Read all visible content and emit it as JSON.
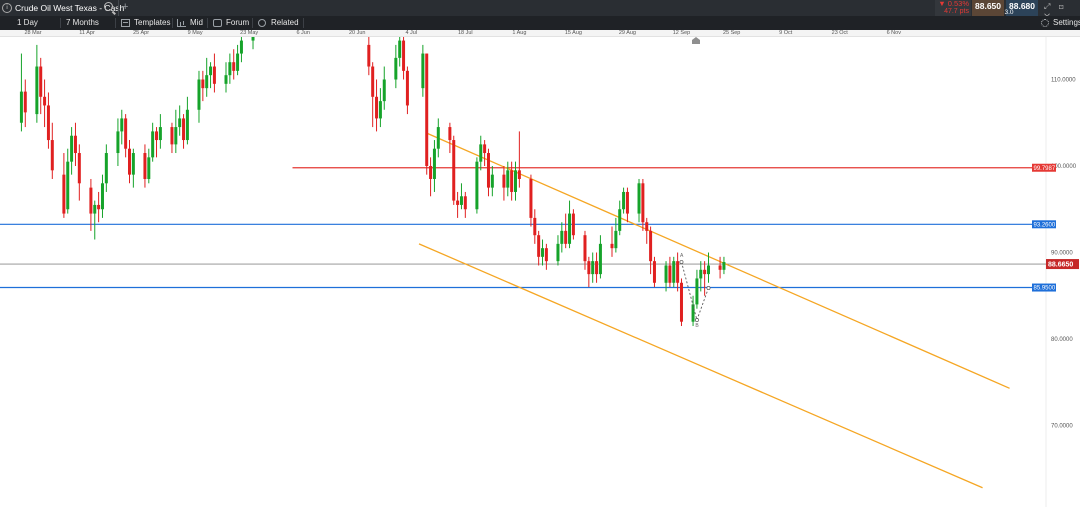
{
  "window": {
    "title": "Crude Oil West Texas - Cash",
    "info_icon": "info-icon",
    "search_icon": "search-icon",
    "add_icon": "plus-icon"
  },
  "quote": {
    "change_pct": "▼ 0.53%",
    "change_pts": "47.7 pts",
    "sell": "88.650",
    "spread": "3.0",
    "buy": "88.680",
    "window_controls": "⤢ ⊡ ✕",
    "colors": {
      "down": "#e53935",
      "sell_bg": "#5b4636",
      "buy_bg": "#2c4359"
    }
  },
  "toolbar": {
    "interval": "1 Day",
    "range": "7 Months",
    "templates": "Templates",
    "mid": "Mid",
    "forum": "Forum",
    "related": "Related",
    "settings": "Settings"
  },
  "date_axis": [
    {
      "label": "28 Mar",
      "day": 0
    },
    {
      "label": "11 Apr",
      "day": 14
    },
    {
      "label": "25 Apr",
      "day": 28
    },
    {
      "label": "9 May",
      "day": 42
    },
    {
      "label": "23 May",
      "day": 56
    },
    {
      "label": "6 Jun",
      "day": 70
    },
    {
      "label": "20 Jun",
      "day": 84
    },
    {
      "label": "4 Jul",
      "day": 98
    },
    {
      "label": "18 Jul",
      "day": 112
    },
    {
      "label": "1 Aug",
      "day": 126
    },
    {
      "label": "15 Aug",
      "day": 140
    },
    {
      "label": "29 Aug",
      "day": 154
    },
    {
      "label": "12 Sep",
      "day": 168
    },
    {
      "label": "25 Sep",
      "day": 181
    },
    {
      "label": "9 Oct",
      "day": 195
    },
    {
      "label": "23 Oct",
      "day": 209
    },
    {
      "label": "6 Nov",
      "day": 223
    }
  ],
  "price_axis": [
    "110.0000",
    "100.0000",
    "90.0000",
    "80.0000",
    "70.0000"
  ],
  "chart_data": {
    "type": "candlestick",
    "instrument": "Crude Oil West Texas - Cash",
    "interval": "1 Day",
    "x_range": [
      "2022-03-25",
      "2022-11-15"
    ],
    "y_range": [
      63,
      118
    ],
    "current_price": {
      "value": 88.665,
      "label": "88.6650"
    },
    "horizontal_levels": [
      {
        "price": 99.7987,
        "label": "99.7987",
        "color": "#e53935",
        "start_day": 75
      },
      {
        "price": 93.26,
        "label": "93.2600",
        "color": "#1e6fd9",
        "start_day": -3
      },
      {
        "price": 85.95,
        "label": "85.9500",
        "color": "#1e6fd9",
        "start_day": -3
      }
    ],
    "channel": {
      "color": "#f5a623",
      "upper": [
        {
          "day": 102,
          "price": 103.8
        },
        {
          "day": 253,
          "price": 74.3
        }
      ],
      "lower": [
        {
          "day": 100,
          "price": 91.0
        },
        {
          "day": 246,
          "price": 62.8
        }
      ]
    },
    "projection": {
      "color": "#555555",
      "points": [
        {
          "day": 168,
          "price": 88.9,
          "label": "A"
        },
        {
          "day": 172,
          "price": 82.2,
          "label": "B"
        },
        {
          "day": 175,
          "price": 85.9,
          "label": ""
        }
      ]
    },
    "candles": [
      {
        "d": -3,
        "o": 105.0,
        "c": 108.6,
        "h": 113.0,
        "l": 104.0
      },
      {
        "d": -2,
        "o": 108.6,
        "c": 106.2,
        "h": 110.0,
        "l": 104.5
      },
      {
        "d": 1,
        "o": 106.0,
        "c": 111.5,
        "h": 114.0,
        "l": 105.0
      },
      {
        "d": 2,
        "o": 111.5,
        "c": 108.0,
        "h": 112.5,
        "l": 106.0
      },
      {
        "d": 3,
        "o": 108.0,
        "c": 107.0,
        "h": 110.0,
        "l": 104.5
      },
      {
        "d": 4,
        "o": 107.0,
        "c": 103.0,
        "h": 108.5,
        "l": 102.0
      },
      {
        "d": 5,
        "o": 103.0,
        "c": 99.5,
        "h": 105.0,
        "l": 98.5
      },
      {
        "d": 8,
        "o": 99.0,
        "c": 94.5,
        "h": 101.5,
        "l": 94.0
      },
      {
        "d": 9,
        "o": 95.0,
        "c": 100.5,
        "h": 102.0,
        "l": 94.5
      },
      {
        "d": 10,
        "o": 100.5,
        "c": 103.5,
        "h": 104.5,
        "l": 99.0
      },
      {
        "d": 11,
        "o": 103.5,
        "c": 101.5,
        "h": 105.0,
        "l": 100.0
      },
      {
        "d": 12,
        "o": 101.5,
        "c": 98.0,
        "h": 102.5,
        "l": 96.0
      },
      {
        "d": 15,
        "o": 97.5,
        "c": 94.5,
        "h": 98.5,
        "l": 92.5
      },
      {
        "d": 16,
        "o": 94.5,
        "c": 95.5,
        "h": 96.0,
        "l": 91.5
      },
      {
        "d": 17,
        "o": 95.5,
        "c": 95.0,
        "h": 97.0,
        "l": 93.5
      },
      {
        "d": 18,
        "o": 95.0,
        "c": 98.0,
        "h": 99.0,
        "l": 94.0
      },
      {
        "d": 19,
        "o": 98.0,
        "c": 101.5,
        "h": 102.5,
        "l": 97.0
      },
      {
        "d": 22,
        "o": 101.5,
        "c": 104.0,
        "h": 105.5,
        "l": 100.0
      },
      {
        "d": 23,
        "o": 104.0,
        "c": 105.5,
        "h": 106.5,
        "l": 102.5
      },
      {
        "d": 24,
        "o": 105.5,
        "c": 102.0,
        "h": 106.0,
        "l": 101.0
      },
      {
        "d": 25,
        "o": 102.0,
        "c": 99.0,
        "h": 103.0,
        "l": 98.0
      },
      {
        "d": 26,
        "o": 99.0,
        "c": 101.5,
        "h": 102.0,
        "l": 97.5
      },
      {
        "d": 29,
        "o": 101.5,
        "c": 98.5,
        "h": 102.5,
        "l": 97.5
      },
      {
        "d": 30,
        "o": 98.5,
        "c": 101.0,
        "h": 102.0,
        "l": 98.0
      },
      {
        "d": 31,
        "o": 101.0,
        "c": 104.0,
        "h": 105.0,
        "l": 100.5
      },
      {
        "d": 32,
        "o": 104.0,
        "c": 103.0,
        "h": 104.5,
        "l": 101.0
      },
      {
        "d": 33,
        "o": 103.0,
        "c": 104.5,
        "h": 106.0,
        "l": 102.0
      },
      {
        "d": 36,
        "o": 104.5,
        "c": 102.5,
        "h": 105.0,
        "l": 101.5
      },
      {
        "d": 37,
        "o": 102.5,
        "c": 104.5,
        "h": 106.5,
        "l": 101.5
      },
      {
        "d": 38,
        "o": 104.5,
        "c": 105.5,
        "h": 107.0,
        "l": 103.5
      },
      {
        "d": 39,
        "o": 105.5,
        "c": 103.0,
        "h": 106.0,
        "l": 102.0
      },
      {
        "d": 40,
        "o": 103.0,
        "c": 106.5,
        "h": 108.0,
        "l": 102.5
      },
      {
        "d": 43,
        "o": 106.5,
        "c": 110.0,
        "h": 111.0,
        "l": 105.0
      },
      {
        "d": 44,
        "o": 110.0,
        "c": 109.0,
        "h": 111.0,
        "l": 107.5
      },
      {
        "d": 45,
        "o": 109.0,
        "c": 110.5,
        "h": 112.5,
        "l": 108.0
      },
      {
        "d": 46,
        "o": 110.5,
        "c": 111.5,
        "h": 112.0,
        "l": 109.0
      },
      {
        "d": 47,
        "o": 111.5,
        "c": 109.5,
        "h": 113.0,
        "l": 108.5
      },
      {
        "d": 50,
        "o": 109.5,
        "c": 110.5,
        "h": 112.0,
        "l": 108.5
      },
      {
        "d": 51,
        "o": 110.5,
        "c": 112.0,
        "h": 113.0,
        "l": 109.5
      },
      {
        "d": 52,
        "o": 112.0,
        "c": 111.0,
        "h": 113.5,
        "l": 110.0
      },
      {
        "d": 53,
        "o": 111.0,
        "c": 113.0,
        "h": 114.0,
        "l": 110.5
      },
      {
        "d": 54,
        "o": 113.0,
        "c": 114.5,
        "h": 115.5,
        "l": 112.0
      },
      {
        "d": 57,
        "o": 114.5,
        "c": 115.5,
        "h": 117.0,
        "l": 113.5
      },
      {
        "d": 59,
        "o": 115.5,
        "c": 118.0,
        "h": 119.0,
        "l": 115.0
      },
      {
        "d": 65,
        "o": 117.0,
        "c": 118.5,
        "h": 119.5,
        "l": 116.5
      },
      {
        "d": 87,
        "o": 114.0,
        "c": 111.5,
        "h": 115.0,
        "l": 110.5
      },
      {
        "d": 88,
        "o": 111.5,
        "c": 108.0,
        "h": 112.0,
        "l": 104.5
      },
      {
        "d": 89,
        "o": 108.0,
        "c": 105.5,
        "h": 110.0,
        "l": 104.0
      },
      {
        "d": 90,
        "o": 105.5,
        "c": 107.5,
        "h": 109.0,
        "l": 104.5
      },
      {
        "d": 91,
        "o": 107.5,
        "c": 110.0,
        "h": 111.5,
        "l": 106.5
      },
      {
        "d": 94,
        "o": 110.0,
        "c": 112.5,
        "h": 114.0,
        "l": 109.0
      },
      {
        "d": 95,
        "o": 112.5,
        "c": 114.5,
        "h": 116.0,
        "l": 111.5
      },
      {
        "d": 96,
        "o": 114.5,
        "c": 111.0,
        "h": 115.0,
        "l": 110.0
      },
      {
        "d": 97,
        "o": 111.0,
        "c": 107.0,
        "h": 111.5,
        "l": 106.0
      },
      {
        "d": 101,
        "o": 109.0,
        "c": 113.0,
        "h": 114.0,
        "l": 108.0
      },
      {
        "d": 102,
        "o": 113.0,
        "c": 100.0,
        "h": 113.0,
        "l": 99.0
      },
      {
        "d": 103,
        "o": 100.0,
        "c": 98.5,
        "h": 101.0,
        "l": 96.5
      },
      {
        "d": 104,
        "o": 98.5,
        "c": 102.0,
        "h": 103.0,
        "l": 97.0
      },
      {
        "d": 105,
        "o": 102.0,
        "c": 104.5,
        "h": 105.5,
        "l": 101.0
      },
      {
        "d": 108,
        "o": 104.5,
        "c": 103.0,
        "h": 105.0,
        "l": 101.5
      },
      {
        "d": 109,
        "o": 103.0,
        "c": 96.0,
        "h": 103.5,
        "l": 95.5
      },
      {
        "d": 110,
        "o": 96.0,
        "c": 95.5,
        "h": 97.0,
        "l": 94.0
      },
      {
        "d": 111,
        "o": 95.5,
        "c": 96.5,
        "h": 98.0,
        "l": 95.0
      },
      {
        "d": 112,
        "o": 96.5,
        "c": 95.0,
        "h": 97.0,
        "l": 94.0
      },
      {
        "d": 115,
        "o": 95.0,
        "c": 100.5,
        "h": 101.0,
        "l": 94.5
      },
      {
        "d": 116,
        "o": 100.5,
        "c": 102.5,
        "h": 103.5,
        "l": 99.5
      },
      {
        "d": 117,
        "o": 102.5,
        "c": 101.5,
        "h": 103.0,
        "l": 100.0
      },
      {
        "d": 118,
        "o": 101.5,
        "c": 97.5,
        "h": 102.0,
        "l": 96.5
      },
      {
        "d": 119,
        "o": 97.5,
        "c": 99.0,
        "h": 100.0,
        "l": 96.5
      },
      {
        "d": 122,
        "o": 99.0,
        "c": 97.5,
        "h": 100.0,
        "l": 96.0
      },
      {
        "d": 123,
        "o": 97.5,
        "c": 99.5,
        "h": 100.5,
        "l": 96.5
      },
      {
        "d": 124,
        "o": 99.5,
        "c": 97.0,
        "h": 100.5,
        "l": 96.0
      },
      {
        "d": 125,
        "o": 97.0,
        "c": 99.5,
        "h": 100.5,
        "l": 96.0
      },
      {
        "d": 126,
        "o": 99.5,
        "c": 98.5,
        "h": 104.0,
        "l": 97.5
      },
      {
        "d": 129,
        "o": 98.5,
        "c": 94.0,
        "h": 99.0,
        "l": 93.0
      },
      {
        "d": 130,
        "o": 94.0,
        "c": 92.0,
        "h": 95.0,
        "l": 91.0
      },
      {
        "d": 131,
        "o": 92.0,
        "c": 89.5,
        "h": 92.5,
        "l": 88.5
      },
      {
        "d": 132,
        "o": 89.5,
        "c": 90.5,
        "h": 91.5,
        "l": 88.5
      },
      {
        "d": 133,
        "o": 90.5,
        "c": 89.0,
        "h": 91.0,
        "l": 88.0
      },
      {
        "d": 136,
        "o": 89.0,
        "c": 91.0,
        "h": 92.0,
        "l": 88.5
      },
      {
        "d": 137,
        "o": 91.0,
        "c": 92.5,
        "h": 93.5,
        "l": 90.0
      },
      {
        "d": 138,
        "o": 92.5,
        "c": 91.0,
        "h": 94.5,
        "l": 90.5
      },
      {
        "d": 139,
        "o": 91.0,
        "c": 94.5,
        "h": 96.0,
        "l": 90.5
      },
      {
        "d": 140,
        "o": 94.5,
        "c": 92.0,
        "h": 95.0,
        "l": 91.5
      },
      {
        "d": 143,
        "o": 92.0,
        "c": 89.0,
        "h": 92.5,
        "l": 88.0
      },
      {
        "d": 144,
        "o": 89.0,
        "c": 87.5,
        "h": 89.5,
        "l": 86.0
      },
      {
        "d": 145,
        "o": 87.5,
        "c": 89.0,
        "h": 90.0,
        "l": 86.5
      },
      {
        "d": 146,
        "o": 89.0,
        "c": 87.5,
        "h": 90.0,
        "l": 86.5
      },
      {
        "d": 147,
        "o": 87.5,
        "c": 91.0,
        "h": 92.0,
        "l": 87.0
      },
      {
        "d": 150,
        "o": 91.0,
        "c": 90.5,
        "h": 93.0,
        "l": 89.5
      },
      {
        "d": 151,
        "o": 90.5,
        "c": 92.5,
        "h": 94.0,
        "l": 90.0
      },
      {
        "d": 152,
        "o": 92.5,
        "c": 95.0,
        "h": 96.0,
        "l": 92.0
      },
      {
        "d": 153,
        "o": 95.0,
        "c": 97.0,
        "h": 97.5,
        "l": 94.5
      },
      {
        "d": 154,
        "o": 97.0,
        "c": 94.5,
        "h": 97.5,
        "l": 93.5
      },
      {
        "d": 157,
        "o": 94.5,
        "c": 98.0,
        "h": 98.5,
        "l": 93.5
      },
      {
        "d": 158,
        "o": 98.0,
        "c": 93.5,
        "h": 98.5,
        "l": 92.5
      },
      {
        "d": 159,
        "o": 93.5,
        "c": 92.5,
        "h": 94.0,
        "l": 91.0
      },
      {
        "d": 160,
        "o": 92.5,
        "c": 89.0,
        "h": 93.0,
        "l": 87.5
      },
      {
        "d": 161,
        "o": 89.0,
        "c": 86.5,
        "h": 89.5,
        "l": 86.0
      },
      {
        "d": 164,
        "o": 86.5,
        "c": 88.5,
        "h": 89.0,
        "l": 85.5
      },
      {
        "d": 165,
        "o": 88.5,
        "c": 86.5,
        "h": 89.5,
        "l": 86.0
      },
      {
        "d": 166,
        "o": 86.5,
        "c": 89.0,
        "h": 89.5,
        "l": 86.0
      },
      {
        "d": 167,
        "o": 89.0,
        "c": 86.5,
        "h": 90.0,
        "l": 85.5
      },
      {
        "d": 168,
        "o": 86.5,
        "c": 82.0,
        "h": 87.0,
        "l": 81.5
      },
      {
        "d": 171,
        "o": 82.0,
        "c": 84.0,
        "h": 85.0,
        "l": 81.5
      },
      {
        "d": 172,
        "o": 84.0,
        "c": 87.0,
        "h": 88.0,
        "l": 83.5
      },
      {
        "d": 173,
        "o": 87.0,
        "c": 88.0,
        "h": 89.0,
        "l": 85.5
      },
      {
        "d": 174,
        "o": 88.0,
        "c": 87.5,
        "h": 89.0,
        "l": 85.0
      },
      {
        "d": 175,
        "o": 87.5,
        "c": 88.5,
        "h": 90.0,
        "l": 86.5
      },
      {
        "d": 178,
        "o": 88.5,
        "c": 88.0,
        "h": 89.5,
        "l": 87.0
      },
      {
        "d": 179,
        "o": 88.0,
        "c": 88.9,
        "h": 89.5,
        "l": 87.5
      }
    ],
    "colors": {
      "up": "#16a32a",
      "down": "#e02020"
    }
  }
}
